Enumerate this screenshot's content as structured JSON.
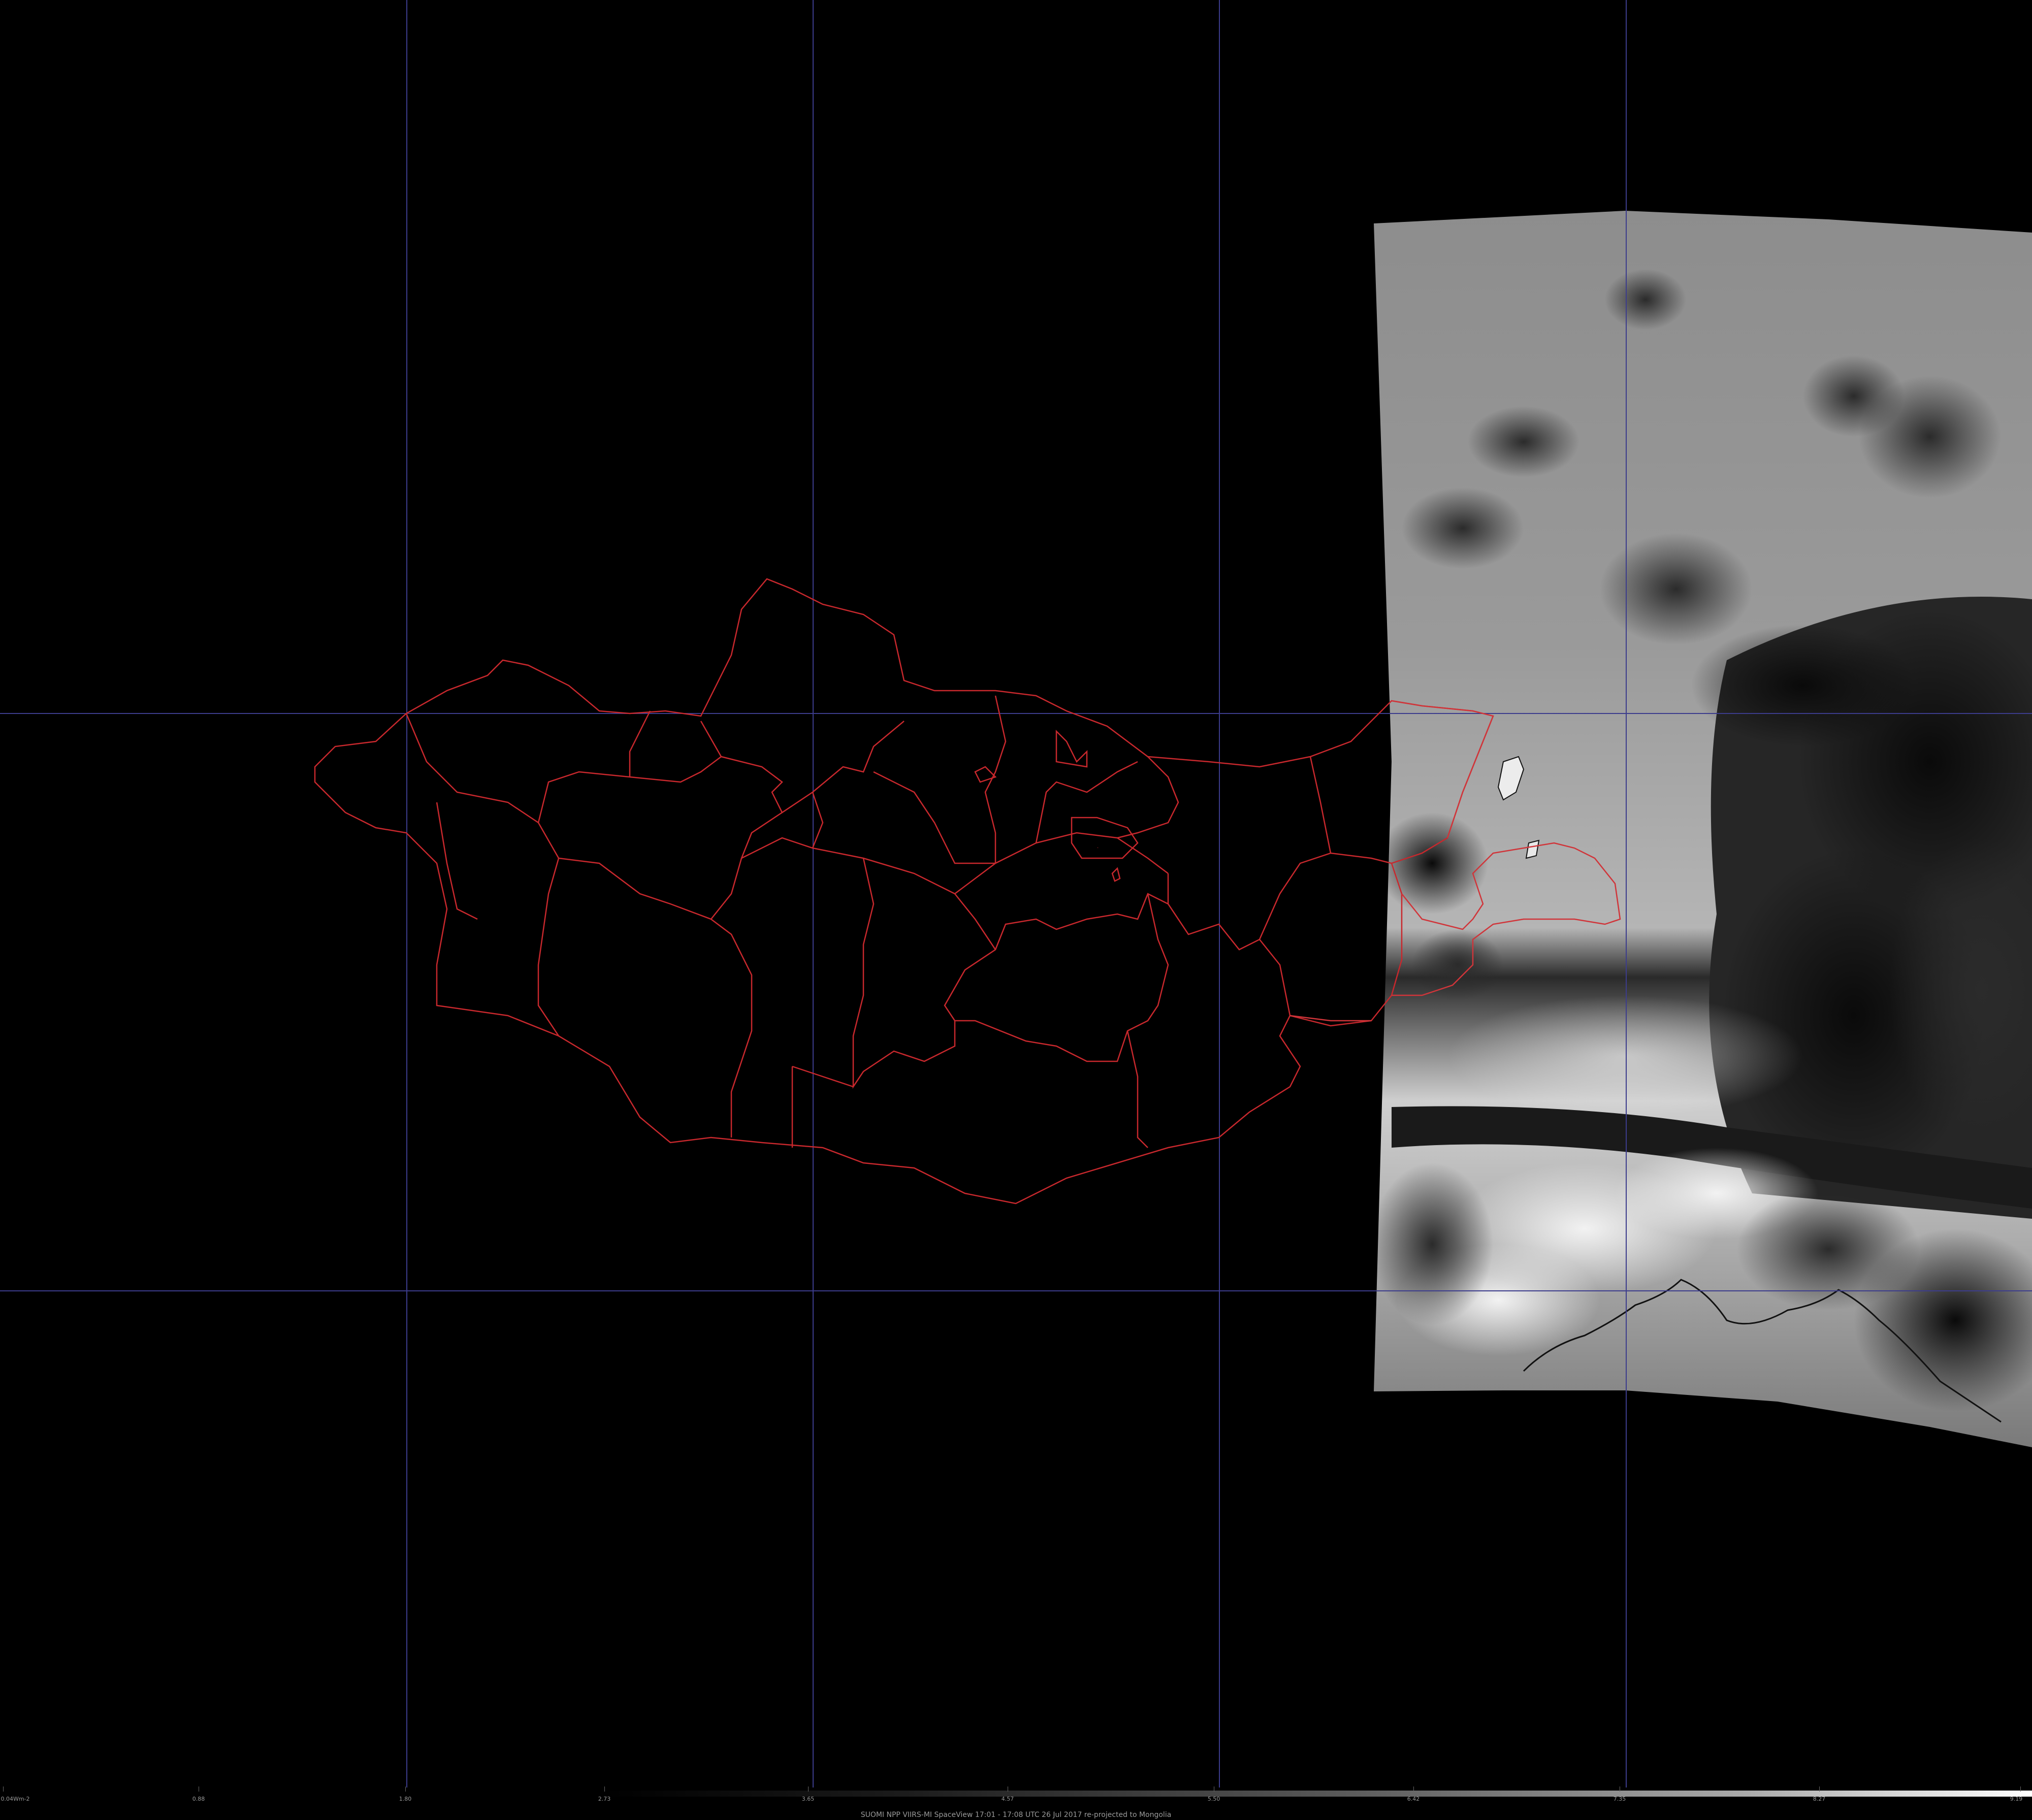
{
  "colors": {
    "background": "#000000",
    "graticule": "#3c3c8c",
    "admin_boundaries": "#c8282d",
    "coastline": "#111111"
  },
  "layers": {
    "graticule": "lat/lon grid lines",
    "boundaries": "Mongolia aimag (province) boundaries",
    "imagery": "VIIRS swath (grayscale) over eastern Mongolia / NE China"
  },
  "scale": {
    "labels": [
      "0.04Wm-2",
      "0.88",
      "1.80",
      "2.73",
      "3.65",
      "4.57",
      "5.50",
      "6.42",
      "7.35",
      "8.27",
      "9.19"
    ]
  },
  "caption": "SUOMI NPP VIIRS-MI SpaceView 17:01 - 17:08 UTC 26 Jul 2017 re-projected to Mongolia"
}
